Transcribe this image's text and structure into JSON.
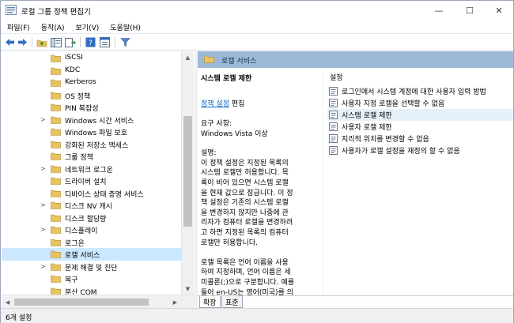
{
  "window": {
    "title": "로컬 그룹 정책 편집기",
    "controls": {
      "minimize": "—",
      "maximize": "☐",
      "close": "✕"
    }
  },
  "menu": [
    "파일(F)",
    "동작(A)",
    "보기(V)",
    "도움말(H)"
  ],
  "toolbar": {
    "buttons": [
      "back-icon",
      "forward-icon",
      "up-folder-icon",
      "show-tree-icon",
      "export-list-icon",
      "help-icon",
      "properties-icon",
      "filter-icon"
    ]
  },
  "tree": {
    "items": [
      "iSCSI",
      "KDC",
      "Kerberos",
      "OS 정책",
      "PIN 복잡성",
      "Windows 시간 서비스",
      "Windows 파일 보호",
      "강화된 저장소 액세스",
      "그룹 정책",
      "네트워크 로그온",
      "드라이버 설치",
      "디바이스 상태 증명 서비스",
      "디스크 NV 캐시",
      "디스크 할당량",
      "디스플레이",
      "로그온",
      "로캘 서비스",
      "문제 해결 및 진단",
      "복구",
      "분산 COM"
    ],
    "expandable": [
      false,
      false,
      false,
      false,
      false,
      true,
      false,
      false,
      false,
      true,
      false,
      false,
      true,
      false,
      true,
      false,
      false,
      true,
      false,
      false
    ],
    "selected_index": 16
  },
  "right": {
    "header": "로캘 서비스",
    "desc": {
      "title": "시스템 로캘 제한",
      "edit_link": "정책 설정",
      "edit_suffix": " 편집",
      "requirements": "요구 사항:\nWindows Vista 이상",
      "description": "설명:\n이 정책 설정은 지정된 목록의\n시스템 로캘만 허용합니다. 목\n록이 비어 있으면 시스템 로캘\n을 현재 값으로 잠급니다. 이 정\n책 설정은 기존의 시스템 로캘\n을 변경하지 않지만 나중에 관\n리자가 컴퓨터 로캘을 변경하려\n고 하면 지정된 목록의 컴퓨터\n로캘만 허용합니다.\n\n로캘 목록은 언어 이름을 사용\n하여 지정하며, 언어 이름은 세\n미콜론(;)으로 구분합니다. 예를\n들어 en-US는 영어(미국)를 의"
    },
    "list": {
      "header": "설정",
      "items": [
        "로그인에서 시스템 계정에 대한 사용자 입력 방법",
        "사용자 지정 로캘을 선택할 수 없음",
        "시스템 로캘 제한",
        "사용자 로캘 제한",
        "지리적 위치를 변경할 수 없음",
        "사용자가 로캘 설정을 재정의 할 수 없음"
      ],
      "selected_index": 2
    },
    "tabs": [
      "확장",
      "표준"
    ]
  },
  "status": "6개 설정",
  "colors": {
    "header_bg": "#9db9d8",
    "selection": "#cce8ff",
    "link": "#0066cc",
    "folder": "#e8c460"
  }
}
